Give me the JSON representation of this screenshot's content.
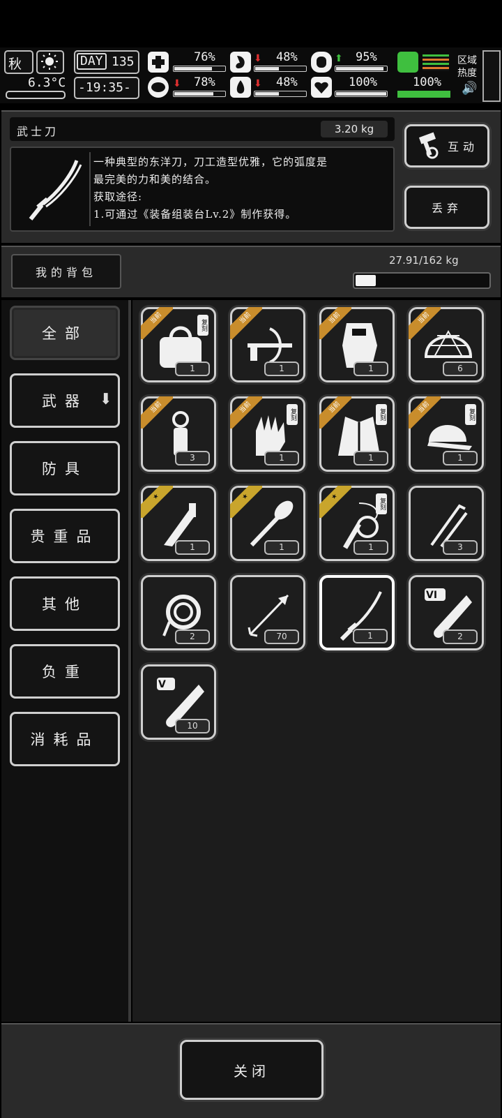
{
  "hud": {
    "season": "秋",
    "temperature": "6.3°C",
    "day_label": "DAY",
    "day_number": "135",
    "time": "-19:35-",
    "stats": {
      "health": "76%",
      "hunger": "48%",
      "energy": "95%",
      "mood": "78%",
      "thirst": "48%",
      "heart": "100%",
      "stamina": "100%"
    },
    "stat_levels": {
      "health": 0.76,
      "hunger": 0.48,
      "energy": 0.95,
      "mood": 0.78,
      "thirst": 0.48,
      "heart": 1.0,
      "stamina": 1.0
    },
    "zone_heat_label": "区域\n热度"
  },
  "item": {
    "name": "武士刀",
    "weight": "3.20 kg",
    "description_line1": "一种典型的东洋刀，刀工造型优雅，它的弧度是",
    "description_line2": "最完美的力和美的结合。",
    "source_label": "获取途径:",
    "source_line": "1.可通过《装备组装台Lv.2》制作获得。",
    "interact_button": "互动",
    "discard_button": "丢弃"
  },
  "backpack": {
    "label": "我的背包",
    "capacity_text": "27.91/162 kg",
    "capacity_fraction": 0.172
  },
  "tabs": [
    "全部",
    "武器",
    "防具",
    "贵重品",
    "其他",
    "负重",
    "消耗品"
  ],
  "slots": [
    {
      "icon": "bag-icon",
      "count": "1",
      "ribbon": "当前",
      "copy": "复刻"
    },
    {
      "icon": "crossbow-icon",
      "count": "1",
      "ribbon": "当前",
      "copy": ""
    },
    {
      "icon": "riot-shield-icon",
      "count": "1",
      "ribbon": "当前",
      "copy": ""
    },
    {
      "icon": "helmet-net-icon",
      "count": "6",
      "ribbon": "当前",
      "copy": ""
    },
    {
      "icon": "grenade-icon",
      "count": "3",
      "ribbon": "当前",
      "copy": ""
    },
    {
      "icon": "gloves-icon",
      "count": "1",
      "ribbon": "当前",
      "copy": "复刻"
    },
    {
      "icon": "coat-icon",
      "count": "1",
      "ribbon": "当前",
      "copy": "复刻"
    },
    {
      "icon": "cap-icon",
      "count": "1",
      "ribbon": "当前",
      "copy": "复刻"
    },
    {
      "icon": "knife-icon",
      "count": "1",
      "ribbon": "★",
      "copy": ""
    },
    {
      "icon": "shovel-icon",
      "count": "1",
      "ribbon": "★",
      "copy": ""
    },
    {
      "icon": "whip-icon",
      "count": "1",
      "ribbon": "★",
      "copy": "复刻"
    },
    {
      "icon": "lockpick-icon",
      "count": "3",
      "ribbon": "",
      "copy": ""
    },
    {
      "icon": "rope-icon",
      "count": "2",
      "ribbon": "",
      "copy": ""
    },
    {
      "icon": "arrow-icon",
      "count": "70",
      "ribbon": "",
      "copy": ""
    },
    {
      "icon": "katana-icon",
      "count": "1",
      "ribbon": "",
      "copy": ""
    },
    {
      "icon": "test-tube-vi-icon",
      "count": "2",
      "ribbon": "",
      "copy": "",
      "tag": "VI"
    },
    {
      "icon": "test-tube-v-icon",
      "count": "10",
      "ribbon": "",
      "copy": "",
      "tag": "V"
    }
  ],
  "close_button": "关闭",
  "colors": {
    "accent_green": "#3fbf3f",
    "ribbon_orange": "#c98d2c",
    "ribbon_gold": "#c9a52c",
    "hp_red": "#e03030"
  }
}
